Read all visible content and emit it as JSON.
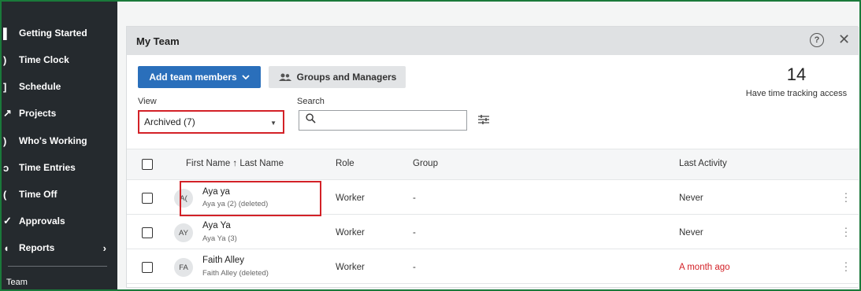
{
  "sidebar": {
    "items": [
      {
        "label": "Getting Started",
        "icon": "flag-icon"
      },
      {
        "label": "Time Clock",
        "icon": "clock-icon"
      },
      {
        "label": "Schedule",
        "icon": "calendar-icon"
      },
      {
        "label": "Projects",
        "icon": "projects-icon"
      },
      {
        "label": "Who's Working",
        "icon": "location-icon"
      },
      {
        "label": "Time Entries",
        "icon": "entries-icon"
      },
      {
        "label": "Time Off",
        "icon": "time-off-icon"
      },
      {
        "label": "Approvals",
        "icon": "approvals-icon"
      },
      {
        "label": "Reports",
        "icon": "reports-icon"
      }
    ],
    "reports_chevron": "›",
    "section_label": "Team"
  },
  "panel": {
    "title": "My Team",
    "help_glyph": "?",
    "close_glyph": "✕"
  },
  "toolbar": {
    "add_label": "Add team members",
    "add_chevron": "⌄",
    "groups_label": "Groups and Managers"
  },
  "summary": {
    "count": "14",
    "label": "Have time tracking access"
  },
  "filters": {
    "view_label": "View",
    "view_value": "Archived (7)",
    "search_label": "Search",
    "search_value": ""
  },
  "table": {
    "headers": {
      "name": "First Name ↑ Last Name",
      "role": "Role",
      "group": "Group",
      "activity": "Last Activity"
    },
    "rows": [
      {
        "initials": "A(",
        "name": "Aya ya",
        "sub": "Aya ya (2) (deleted)",
        "role": "Worker",
        "group": "-",
        "activity": "Never",
        "activity_color": "#333333"
      },
      {
        "initials": "AY",
        "name": "Aya Ya",
        "sub": "Aya Ya (3)",
        "role": "Worker",
        "group": "-",
        "activity": "Never",
        "activity_color": "#333333"
      },
      {
        "initials": "FA",
        "name": "Faith Alley",
        "sub": "Faith Alley (deleted)",
        "role": "Worker",
        "group": "-",
        "activity": "A month ago",
        "activity_color": "#d32127"
      }
    ]
  },
  "colors": {
    "sidebar_bg": "#252a2e",
    "primary_button": "#2a6fbb",
    "highlight": "#d32127",
    "frame_border": "#1a7a3a"
  }
}
